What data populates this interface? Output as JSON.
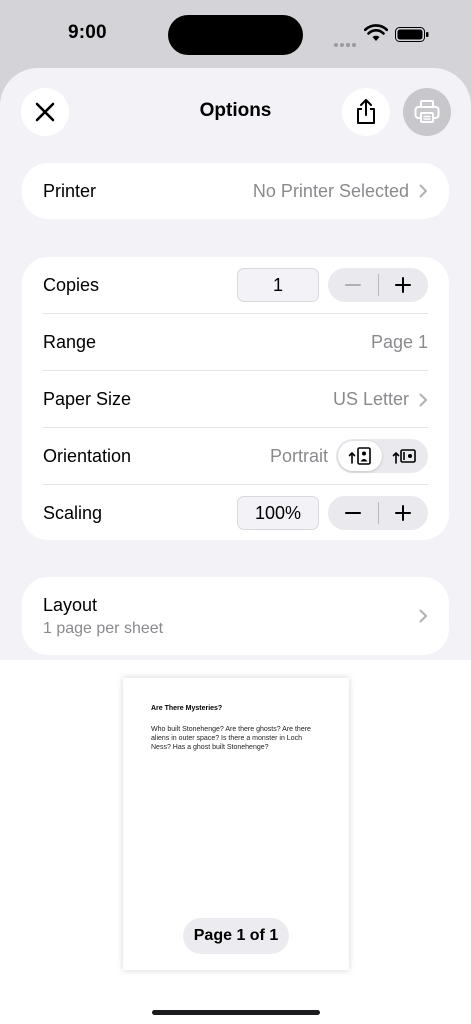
{
  "status": {
    "time": "9:00"
  },
  "header": {
    "title": "Options"
  },
  "printer": {
    "label": "Printer",
    "value": "No Printer Selected"
  },
  "copies": {
    "label": "Copies",
    "value": "1"
  },
  "range": {
    "label": "Range",
    "value": "Page 1"
  },
  "paper_size": {
    "label": "Paper Size",
    "value": "US Letter"
  },
  "orientation": {
    "label": "Orientation",
    "value": "Portrait"
  },
  "scaling": {
    "label": "Scaling",
    "value": "100%"
  },
  "layout": {
    "label": "Layout",
    "value": "1 page per sheet"
  },
  "preview": {
    "doc_title": "Are There Mysteries?",
    "doc_body": "Who built Stonehenge? Are there ghosts? Are there aliens in outer space? Is there a monster in Loch Ness? Has a ghost built Stonehenge?",
    "page_indicator": "Page 1 of 1"
  },
  "icons": {
    "close": "close-icon",
    "share": "share-icon",
    "print": "printer-icon",
    "minus": "minus-icon",
    "plus": "plus-icon",
    "chevron": "chevron-right-icon",
    "portrait": "portrait-orientation-icon",
    "landscape": "landscape-orientation-icon"
  },
  "colors": {
    "sheet_bg": "#f2f2f7",
    "secondary_text": "#8a8a8e",
    "disabled_fill": "#c7c7cc"
  }
}
